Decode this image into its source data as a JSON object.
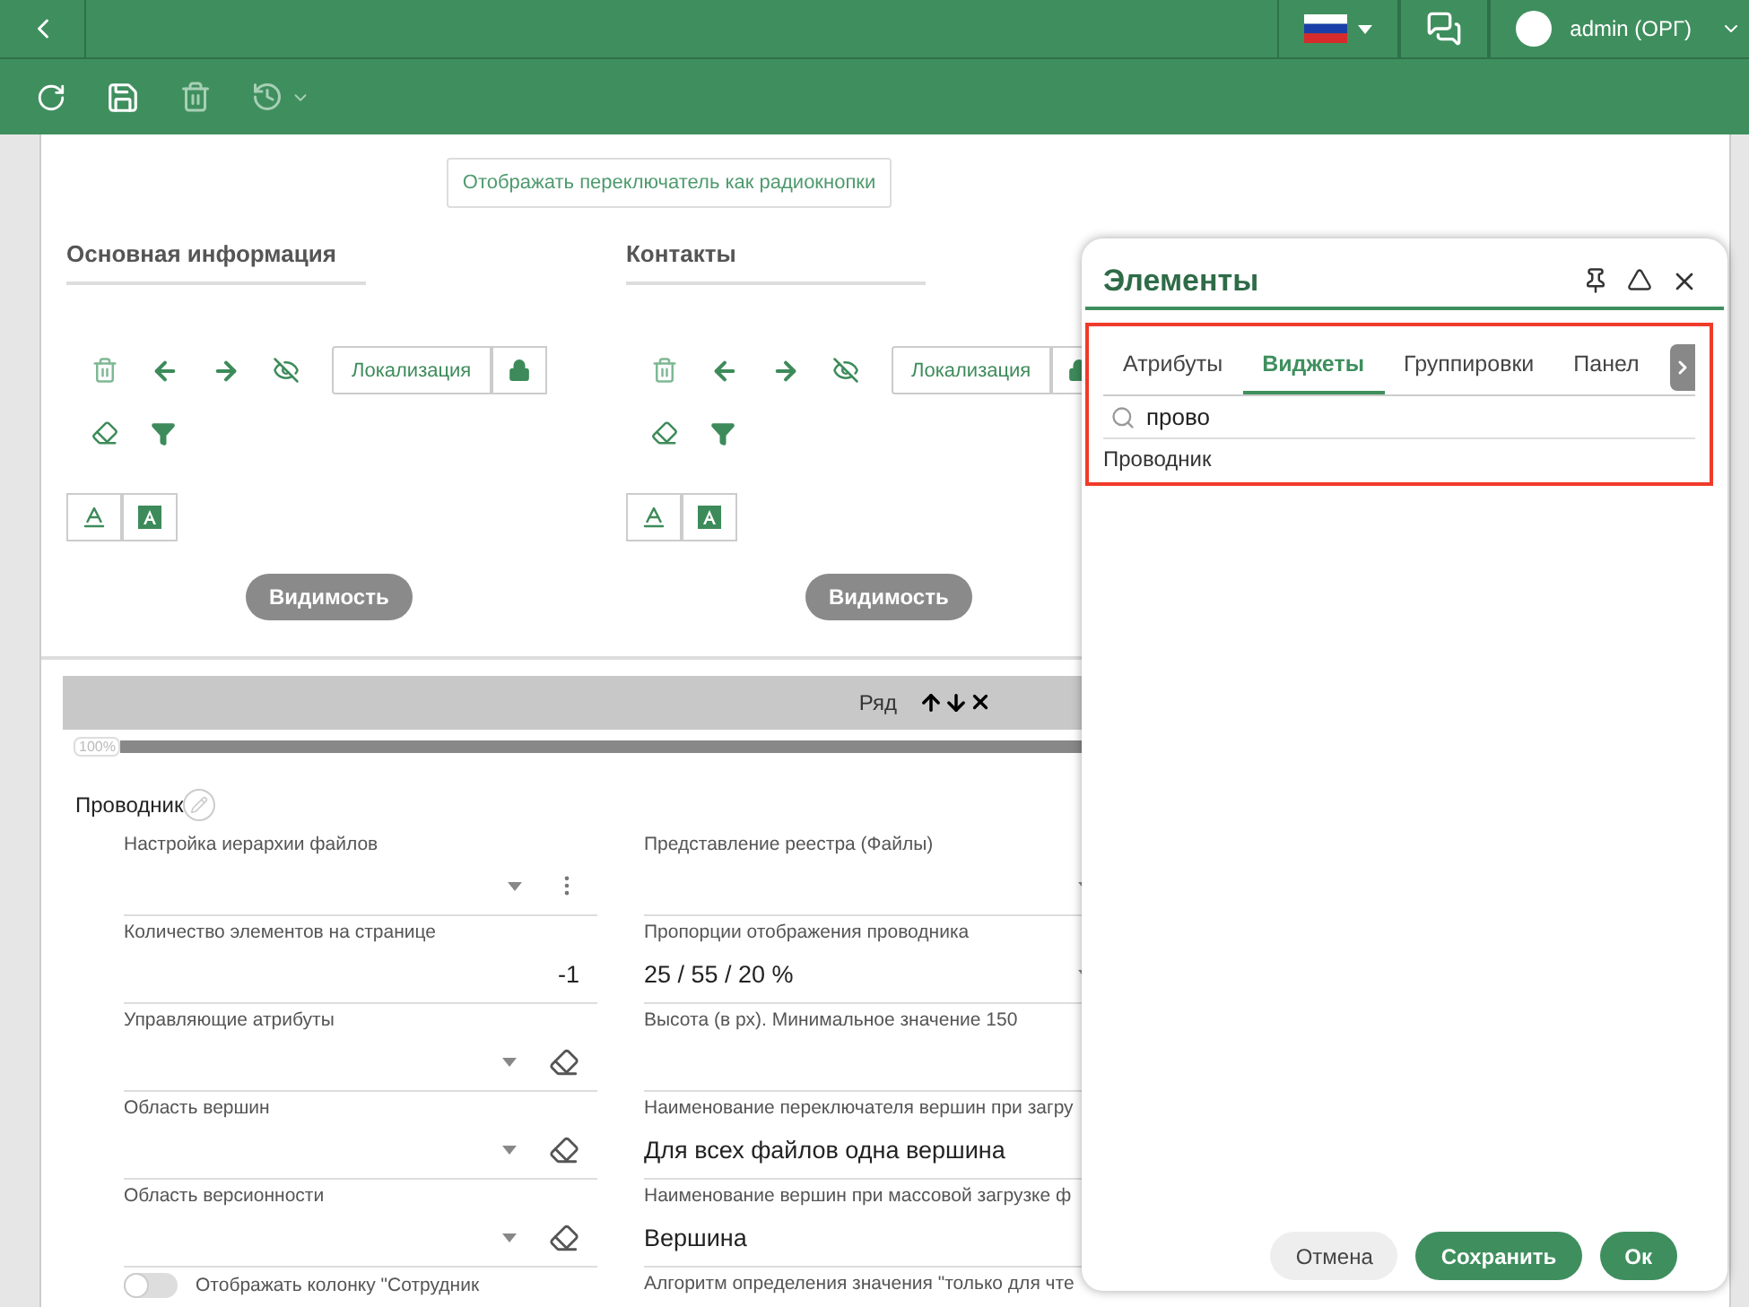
{
  "header": {
    "user": "admin (ОРГ)"
  },
  "switch_button": "Отображать переключатель как радиокнопки",
  "sections": [
    {
      "title": "Основная информация",
      "localize": "Локализация",
      "visibility": "Видимость"
    },
    {
      "title": "Контакты",
      "localize": "Локализация",
      "visibility": "Видимость"
    }
  ],
  "row_bar": {
    "label": "Ряд"
  },
  "progress": {
    "label": "100%",
    "level": 1
  },
  "widget": {
    "title": "Проводник"
  },
  "fields_left": [
    {
      "label": "Настройка иерархии файлов",
      "kind": "menu"
    },
    {
      "label": "Количество элементов на странице",
      "kind": "number",
      "value": "-1"
    },
    {
      "label": "Управляющие атрибуты",
      "kind": "clearable"
    },
    {
      "label": "Область вершин",
      "kind": "clearable"
    },
    {
      "label": "Область версионности",
      "kind": "clearable"
    }
  ],
  "toggle": {
    "label": "Отображать колонку \"Сотрудник",
    "on": false
  },
  "fields_right": [
    {
      "label": "Представление реестра (Файлы)",
      "kind": "select"
    },
    {
      "label": "Пропорции отображения проводника",
      "kind": "select",
      "value": "25 / 55 / 20 %"
    },
    {
      "label": "Высота (в px). Минимальное значение 150",
      "kind": "number"
    },
    {
      "label": "Наименование переключателя вершин при загру",
      "kind": "text",
      "value": "Для всех файлов одна вершина"
    },
    {
      "label": "Наименование вершин при массовой загрузке ф",
      "kind": "text",
      "value": "Вершина"
    },
    {
      "label": "Алгоритм определения значения \"только для чте",
      "kind": "label"
    }
  ],
  "dialog": {
    "title": "Элементы",
    "tabs": [
      {
        "label": "Атрибуты",
        "selected": false
      },
      {
        "label": "Виджеты",
        "selected": true
      },
      {
        "label": "Группировки",
        "selected": false
      },
      {
        "label": "Панел",
        "selected": false
      }
    ],
    "search": {
      "value": "прово"
    },
    "results": [
      "Проводник"
    ],
    "buttons": [
      {
        "label": "Отмена",
        "kind": "secondary"
      },
      {
        "label": "Сохранить",
        "kind": "primary"
      },
      {
        "label": "Ок",
        "kind": "primary"
      }
    ]
  }
}
